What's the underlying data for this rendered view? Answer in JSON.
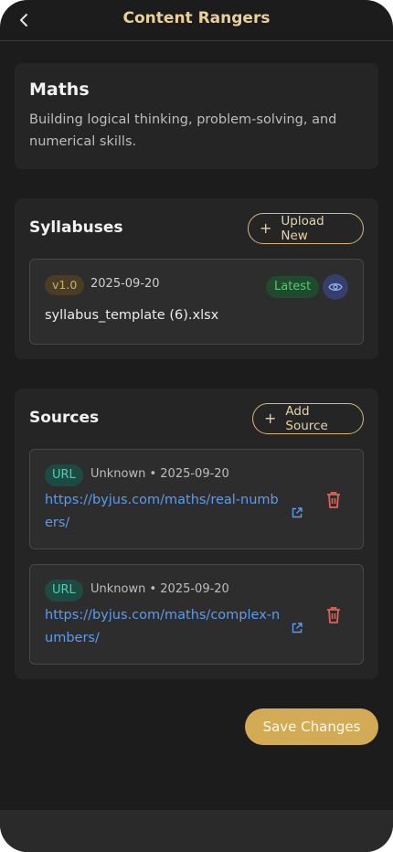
{
  "header": {
    "title": "Content Rangers",
    "back_icon": "chevron-left-icon"
  },
  "subject": {
    "title": "Maths",
    "description": "Building logical thinking, problem-solving, and numerical skills."
  },
  "syllabuses": {
    "heading": "Syllabuses",
    "upload_label": "Upload New",
    "items": [
      {
        "version": "v1.0",
        "date": "2025-09-20",
        "status": "Latest",
        "file_name": "syllabus_template (6).xlsx",
        "view_icon": "eye-icon"
      }
    ]
  },
  "sources": {
    "heading": "Sources",
    "add_label": "Add Source",
    "items": [
      {
        "type": "URL",
        "meta": "Unknown • 2025-09-20",
        "url": "https://byjus.com/maths/real-numbers/"
      },
      {
        "type": "URL",
        "meta": "Unknown • 2025-09-20",
        "url": "https://byjus.com/maths/complex-numbers/"
      }
    ]
  },
  "actions": {
    "save_label": "Save Changes"
  },
  "colors": {
    "accent": "#d3aa55",
    "title": "#e9cf9a",
    "link": "#5b9cf0",
    "delete": "#e0625a",
    "latest": "#59c777",
    "url_badge": "#5bc9b2",
    "background": "#1c1c1c"
  }
}
